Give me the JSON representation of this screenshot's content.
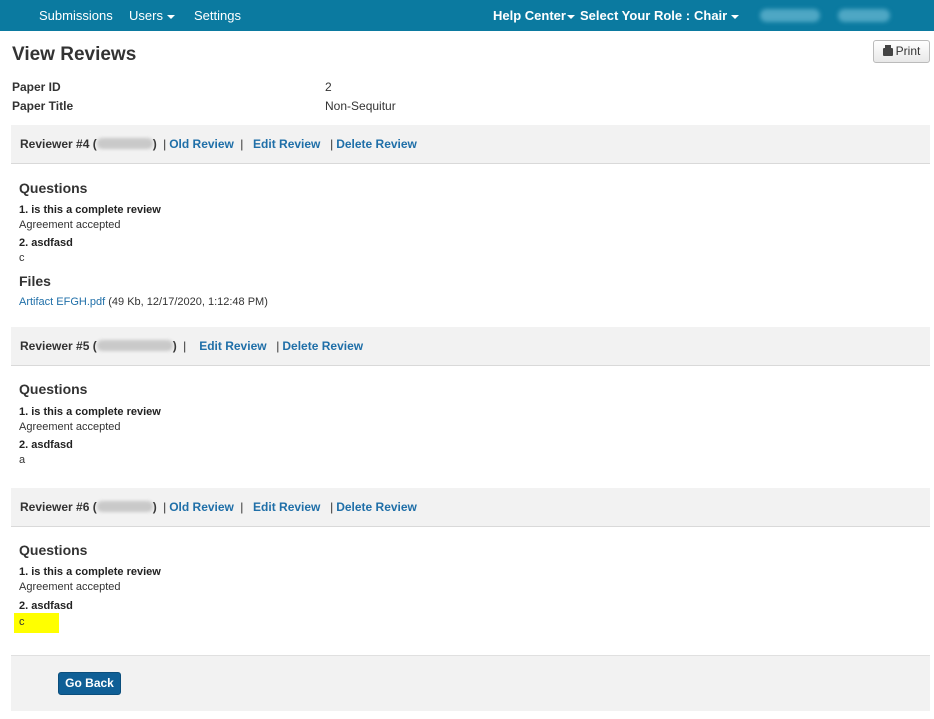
{
  "navbar": {
    "submissions": "Submissions",
    "users": "Users",
    "settings": "Settings",
    "help_center": "Help Center",
    "select_role": "Select Your Role :",
    "role": "Chair"
  },
  "page": {
    "title": "View Reviews",
    "print_label": "Print"
  },
  "paper": {
    "id_label": "Paper ID",
    "id_value": "2",
    "title_label": "Paper Title",
    "title_value": "Non-Sequitur"
  },
  "reviews": [
    {
      "reviewer": "Reviewer #4",
      "old_review": "Old Review",
      "edit_review": "Edit Review",
      "delete_review": "Delete Review",
      "questions_title": "Questions",
      "questions": [
        {
          "q": "1. is this a complete review",
          "a": "Agreement accepted"
        },
        {
          "q": "2. asdfasd",
          "a": "c"
        }
      ],
      "files_title": "Files",
      "file_name": "Artifact EFGH.pdf",
      "file_meta": "(49 Kb, 12/17/2020, 1:12:48 PM)"
    },
    {
      "reviewer": "Reviewer #5",
      "edit_review": "Edit Review",
      "delete_review": "Delete Review",
      "questions_title": "Questions",
      "questions": [
        {
          "q": "1. is this a complete review",
          "a": "Agreement accepted"
        },
        {
          "q": "2. asdfasd",
          "a": "a"
        }
      ]
    },
    {
      "reviewer": "Reviewer #6",
      "old_review": "Old Review",
      "edit_review": "Edit Review",
      "delete_review": "Delete Review",
      "questions_title": "Questions",
      "questions": [
        {
          "q": "1. is this a complete review",
          "a": "Agreement accepted"
        },
        {
          "q": "2. asdfasd",
          "a": "c"
        }
      ]
    }
  ],
  "footer": {
    "go_back": "Go Back"
  },
  "colors": {
    "navbar": "#0b7aa0",
    "link": "#1f6fa8",
    "button": "#0f5f96",
    "highlight": "#ffff00"
  }
}
